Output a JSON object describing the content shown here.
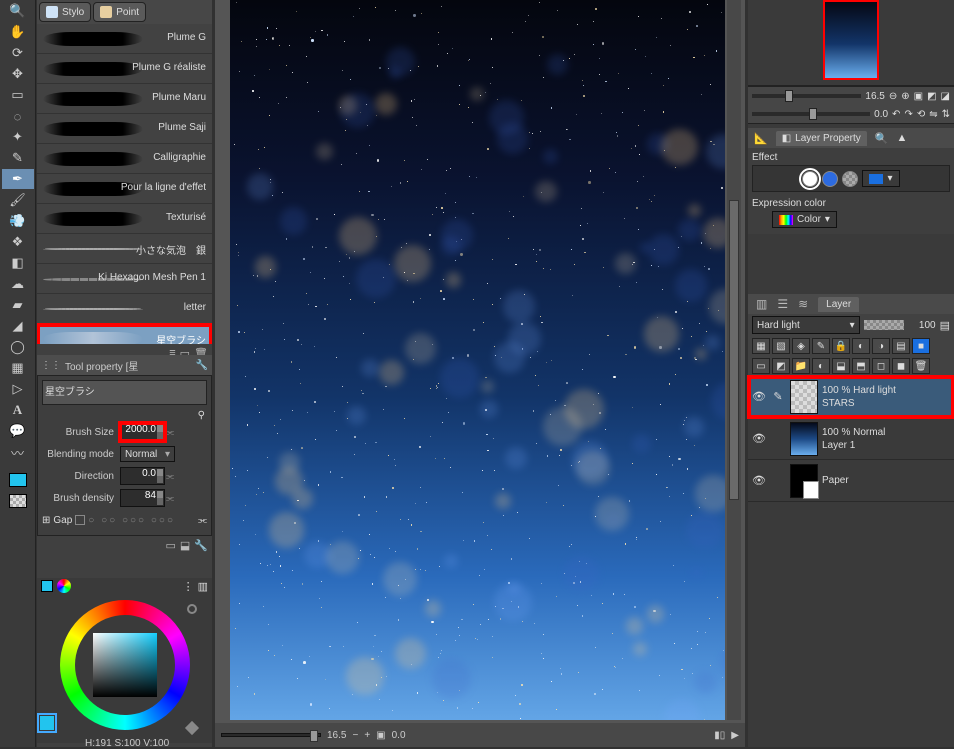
{
  "subtool_tabs": {
    "a": "Stylo",
    "b": "Point"
  },
  "brushes": [
    {
      "label": "Plume G",
      "style": "stroke"
    },
    {
      "label": "Plume G réaliste",
      "style": "stroke"
    },
    {
      "label": "Plume Maru",
      "style": "stroke"
    },
    {
      "label": "Plume Saji",
      "style": "stroke"
    },
    {
      "label": "Calligraphie",
      "style": "stroke"
    },
    {
      "label": "Pour la ligne d'effet",
      "style": "stroke"
    },
    {
      "label": "Texturisé",
      "style": "stroke"
    },
    {
      "label": "小さな気泡　銀",
      "style": "dotted"
    },
    {
      "label": "Ki Hexagon Mesh Pen 1",
      "style": "dashed"
    },
    {
      "label": "letter",
      "style": "dotted"
    },
    {
      "label": "星空ブラシ",
      "style": "light",
      "selected": true
    }
  ],
  "tool_property": {
    "title": "Tool property [星",
    "brush_name": "星空ブラシ",
    "brush_size_label": "Brush Size",
    "brush_size": "2000.0",
    "blending_label": "Blending mode",
    "blending_value": "Normal",
    "direction_label": "Direction",
    "direction_value": "0.0",
    "density_label": "Brush density",
    "density_value": "84",
    "gap_label": "Gap"
  },
  "color": {
    "hsv": "H:191 S:100 V:100"
  },
  "canvas_bar": {
    "zoom": "16.5",
    "angle": "0.0"
  },
  "navigator": {
    "zoom": "16.5",
    "angle": "0.0"
  },
  "layer_property": {
    "title": "Layer Property",
    "effect_label": "Effect",
    "expr_label": "Expression color",
    "expr_value": "Color"
  },
  "layer_panel": {
    "title": "Layer",
    "blend_mode": "Hard light",
    "opacity": "100",
    "layers": [
      {
        "opacity_line": "100 % Hard light",
        "name": "STARS",
        "thumb": "tex",
        "selected": true,
        "pen": true
      },
      {
        "opacity_line": "100 % Normal",
        "name": "Layer 1",
        "thumb": "grad"
      },
      {
        "opacity_line": "",
        "name": "Paper",
        "thumb": "black"
      }
    ]
  }
}
